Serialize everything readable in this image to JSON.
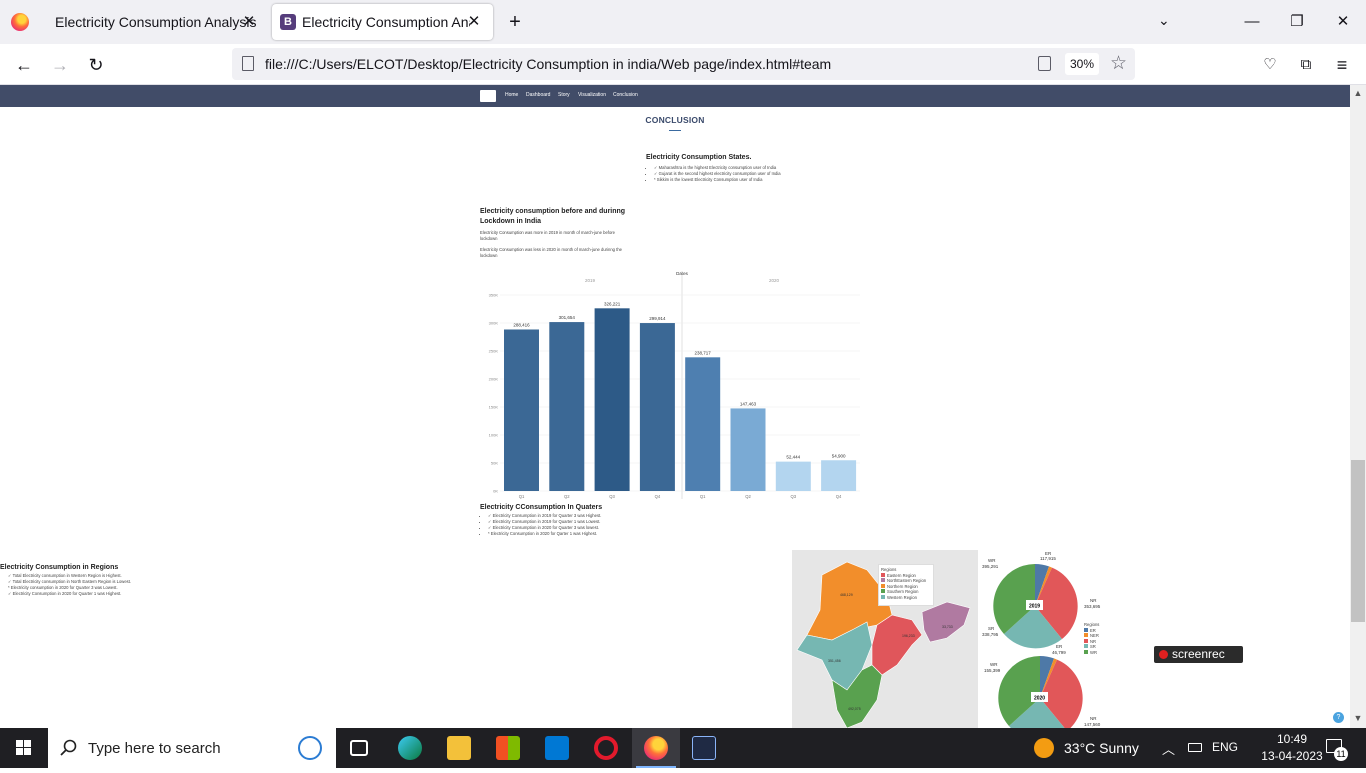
{
  "browser": {
    "tabs": [
      {
        "title": "Electricity Consumption Analysis"
      },
      {
        "title": "Electricity Consumption Analysis"
      }
    ],
    "url": "file:///C:/Users/ELCOT/Desktop/Electricity Consumption in india/Web page/index.html#team",
    "zoom": "30%"
  },
  "site": {
    "nav": [
      "Home",
      "Dashboard",
      "Story",
      "Visualization",
      "Conclusion"
    ],
    "section_title": "CONCLUSION",
    "states": {
      "title": "Electricity Consumption States.",
      "items": [
        "✓ Maharashtra is the highest Electricity consumption user of India",
        "✓ Gujarat is the second highest electricity consumption user of India",
        "* Sikkim is the lowest Electricity Consumption user of India"
      ]
    },
    "lockdown": {
      "title": "Electricity consumption before and durinng Lockdown in India",
      "para1": "Electricity Consumption was more in 2019 in month of march-june before lockdown",
      "para2": "Electricity Consumption was less in 2020 in month of march-june durinng the lockdown"
    },
    "quarters": {
      "title": "Electricity CConsumption In Quaters",
      "items": [
        "✓ Electricity Consumption in 2019 for Quarter 3 was Highest.",
        "✓ Electricity Consumption in 2019 for Quarter 1 was Lowest.",
        "✓ Electricity Consumption in 2020 for Quarter 3 was lowest.",
        "* Electricity Consumption in 2020 for Qarter 1 was Highest."
      ]
    },
    "regions": {
      "title": "Electricity Consumption in Regions",
      "items": [
        "✓ Total Electricity consumption in Western Region is Highest.",
        "✓ Total Electricity consumption in North Eastern Region is Lowest.",
        "* Electricity consumption in 2020 for Quarter 3 was Lowest.",
        "✓ Electricity Consumption in 2020 for Quarter 1 was Highest."
      ]
    },
    "map_legend": {
      "title": "Regions",
      "items": [
        {
          "name": "Eastern Region",
          "color": "#e0565b"
        },
        {
          "name": "NorthEastern Region",
          "color": "#b07aa1"
        },
        {
          "name": "Northern Region",
          "color": "#f28e2b"
        },
        {
          "name": "Southern Region",
          "color": "#59a14f"
        },
        {
          "name": "Western Region",
          "color": "#76b7b2"
        }
      ]
    },
    "pie_legend": {
      "title": "Regions",
      "items": [
        {
          "name": "ER",
          "color": "#4e79a7"
        },
        {
          "name": "NER",
          "color": "#f28e2b"
        },
        {
          "name": "NR",
          "color": "#e15759"
        },
        {
          "name": "SR",
          "color": "#76b7b2"
        },
        {
          "name": "WR",
          "color": "#59a14f"
        }
      ]
    },
    "pie_labels": {
      "p2019": [
        {
          "name": "ER",
          "value": "117,915"
        },
        {
          "name": "WR",
          "value": "395,291"
        },
        {
          "name": "NR",
          "value": "353,695"
        },
        {
          "name": "SR",
          "value": "338,795"
        }
      ],
      "p2020": [
        {
          "name": "ER",
          "value": "46,799"
        },
        {
          "name": "WR",
          "value": "155,399"
        },
        {
          "name": "NR",
          "value": "147,560"
        }
      ]
    },
    "map_values": [
      "468,129",
      "351,456",
      "196,233",
      "33,733",
      "492,075",
      "339,270"
    ]
  },
  "chart_data": {
    "type": "bar",
    "title": "Dates",
    "groups": [
      "2019",
      "2020"
    ],
    "categories": [
      "Q1",
      "Q2",
      "Q3",
      "Q4",
      "Q1",
      "Q2",
      "Q3",
      "Q4"
    ],
    "values": [
      288416,
      301654,
      326221,
      299914,
      238717,
      147463,
      52444,
      54900
    ],
    "value_labels": [
      "288,416",
      "301,654",
      "326,221",
      "299,914",
      "238,717",
      "147,463",
      "52,444",
      "54,900"
    ],
    "colors": [
      "#3b6895",
      "#3b6895",
      "#2d5a87",
      "#3b6895",
      "#4e7fb0",
      "#7aaad4",
      "#b3d5ef",
      "#b3d5ef"
    ],
    "yticks": [
      "0K",
      "50K",
      "100K",
      "150K",
      "200K",
      "250K",
      "300K",
      "350K"
    ],
    "ylim": [
      0,
      350000
    ]
  },
  "taskbar": {
    "search_placeholder": "Type here to search",
    "weather": "33°C  Sunny",
    "lang": "ENG",
    "time": "10:49",
    "date": "13-04-2023",
    "notif_count": "11"
  },
  "screenrec": "screenrec"
}
